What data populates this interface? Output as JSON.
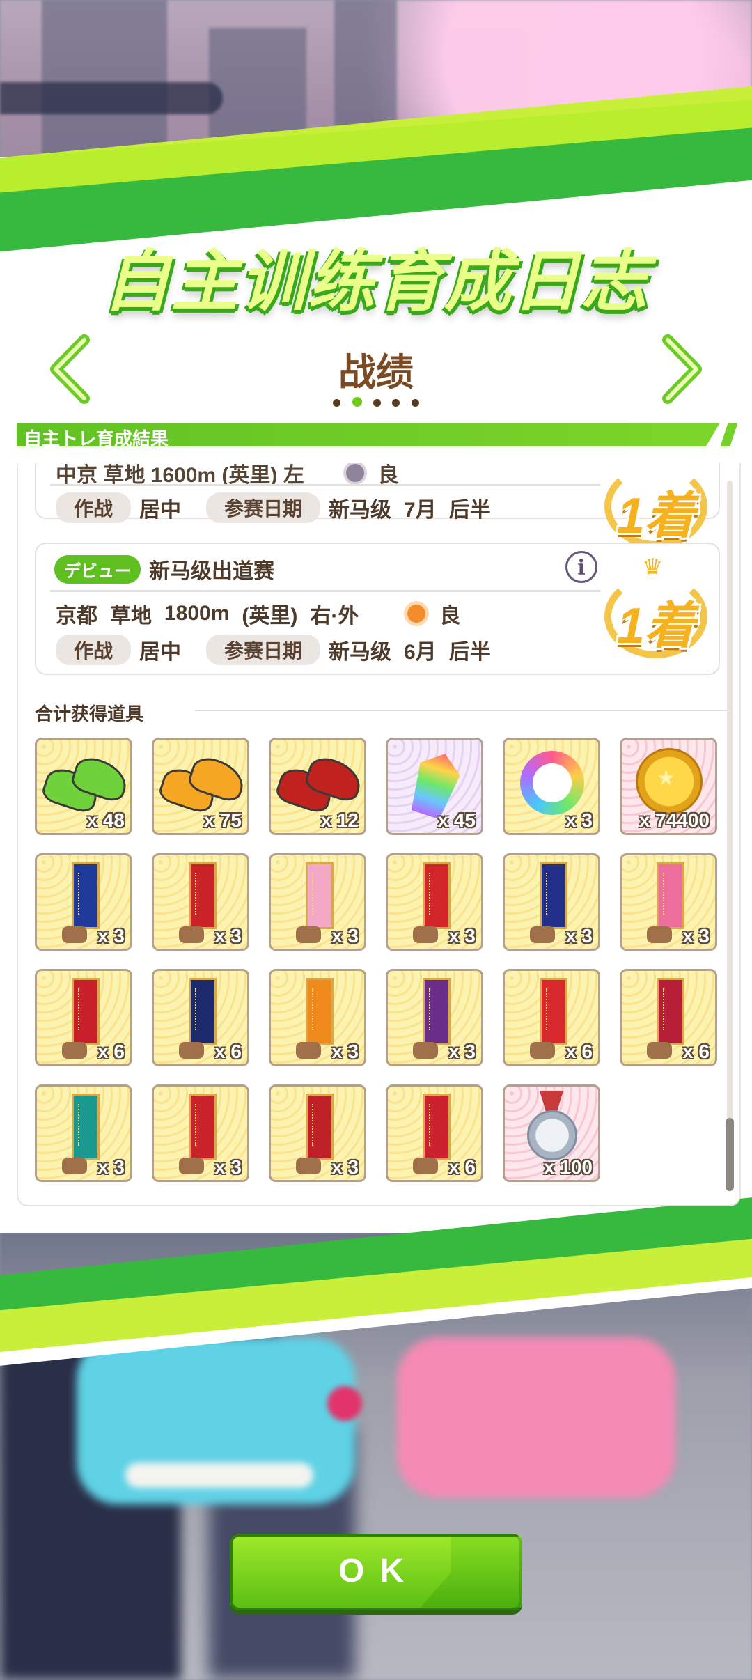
{
  "title": "自主训练育成日志",
  "section": {
    "label": "战绩",
    "page_count": 5,
    "active_page": 2
  },
  "header_bar": "自主トレ育成結果",
  "races": [
    {
      "partial": true,
      "name_row_clipped": "中京 草地 1600m (英里) 左",
      "condition": "良",
      "strategy_label": "作战",
      "strategy": "居中",
      "date_label": "参赛日期",
      "date": [
        "新马级",
        "7月",
        "后半"
      ],
      "result": "1着"
    },
    {
      "partial": false,
      "tag": "デビュー",
      "name": "新马级出道赛",
      "track": [
        "京都",
        "草地",
        "1800m",
        "(英里)",
        "右·外"
      ],
      "weather": "sunny",
      "condition": "良",
      "strategy_label": "作战",
      "strategy": "居中",
      "date_label": "参赛日期",
      "date": [
        "新马级",
        "6月",
        "后半"
      ],
      "result": "1着"
    }
  ],
  "items_label": "合计获得道具",
  "items": [
    {
      "icon": "green-shoes-icon",
      "qty": "x 48",
      "bg": "gold"
    },
    {
      "icon": "orange-shoes-icon",
      "qty": "x 75",
      "bg": "gold"
    },
    {
      "icon": "red-shoes-icon",
      "qty": "x 12",
      "bg": "gold"
    },
    {
      "icon": "rainbow-crystal-icon",
      "qty": "x 45",
      "bg": "purple"
    },
    {
      "icon": "rainbow-horseshoe-icon",
      "qty": "x 3",
      "bg": "gold"
    },
    {
      "icon": "gold-coin-icon",
      "qty": "x 74400",
      "bg": "pink"
    },
    {
      "icon": "blue-pennant-icon",
      "qty": "x 3",
      "bg": "gold",
      "color": "#1f3a9a"
    },
    {
      "icon": "red-pennant-icon",
      "qty": "x 3",
      "bg": "gold",
      "color": "#c8242a"
    },
    {
      "icon": "pink-pennant-icon",
      "qty": "x 3",
      "bg": "gold",
      "color": "#f2a8c6"
    },
    {
      "icon": "red-pennant-icon",
      "qty": "x 3",
      "bg": "gold",
      "color": "#d2262a"
    },
    {
      "icon": "navy-pennant-icon",
      "qty": "x 3",
      "bg": "gold",
      "color": "#23308a"
    },
    {
      "icon": "pink-pennant-icon",
      "qty": "x 3",
      "bg": "gold",
      "color": "#ee6f9c"
    },
    {
      "icon": "red-pennant-icon",
      "qty": "x 6",
      "bg": "gold",
      "color": "#c8202a"
    },
    {
      "icon": "navy-pennant-icon",
      "qty": "x 6",
      "bg": "gold",
      "color": "#1d2a6e"
    },
    {
      "icon": "orange-pennant-icon",
      "qty": "x 3",
      "bg": "gold",
      "color": "#f08a1c"
    },
    {
      "icon": "purple-pennant-icon",
      "qty": "x 3",
      "bg": "gold",
      "color": "#6a2d8a"
    },
    {
      "icon": "red-pennant-icon",
      "qty": "x 6",
      "bg": "gold",
      "color": "#d8282e"
    },
    {
      "icon": "crimson-pennant-icon",
      "qty": "x 6",
      "bg": "gold",
      "color": "#b51e36"
    },
    {
      "icon": "teal-pennant-icon",
      "qty": "x 3",
      "bg": "gold",
      "color": "#1a9a8e"
    },
    {
      "icon": "red-pennant-icon",
      "qty": "x 3",
      "bg": "gold",
      "color": "#c9242c"
    },
    {
      "icon": "red-pennant-icon",
      "qty": "x 3",
      "bg": "gold",
      "color": "#c02028"
    },
    {
      "icon": "red-pennant-icon",
      "qty": "x 6",
      "bg": "gold",
      "color": "#cc2230"
    },
    {
      "icon": "medal-icon",
      "qty": "x 100",
      "bg": "pink"
    }
  ],
  "ok_button": "OK",
  "colors": {
    "accent_green": "#6fcc1a",
    "brown_text": "#4e3a2a",
    "gold": "#f6b21e"
  }
}
